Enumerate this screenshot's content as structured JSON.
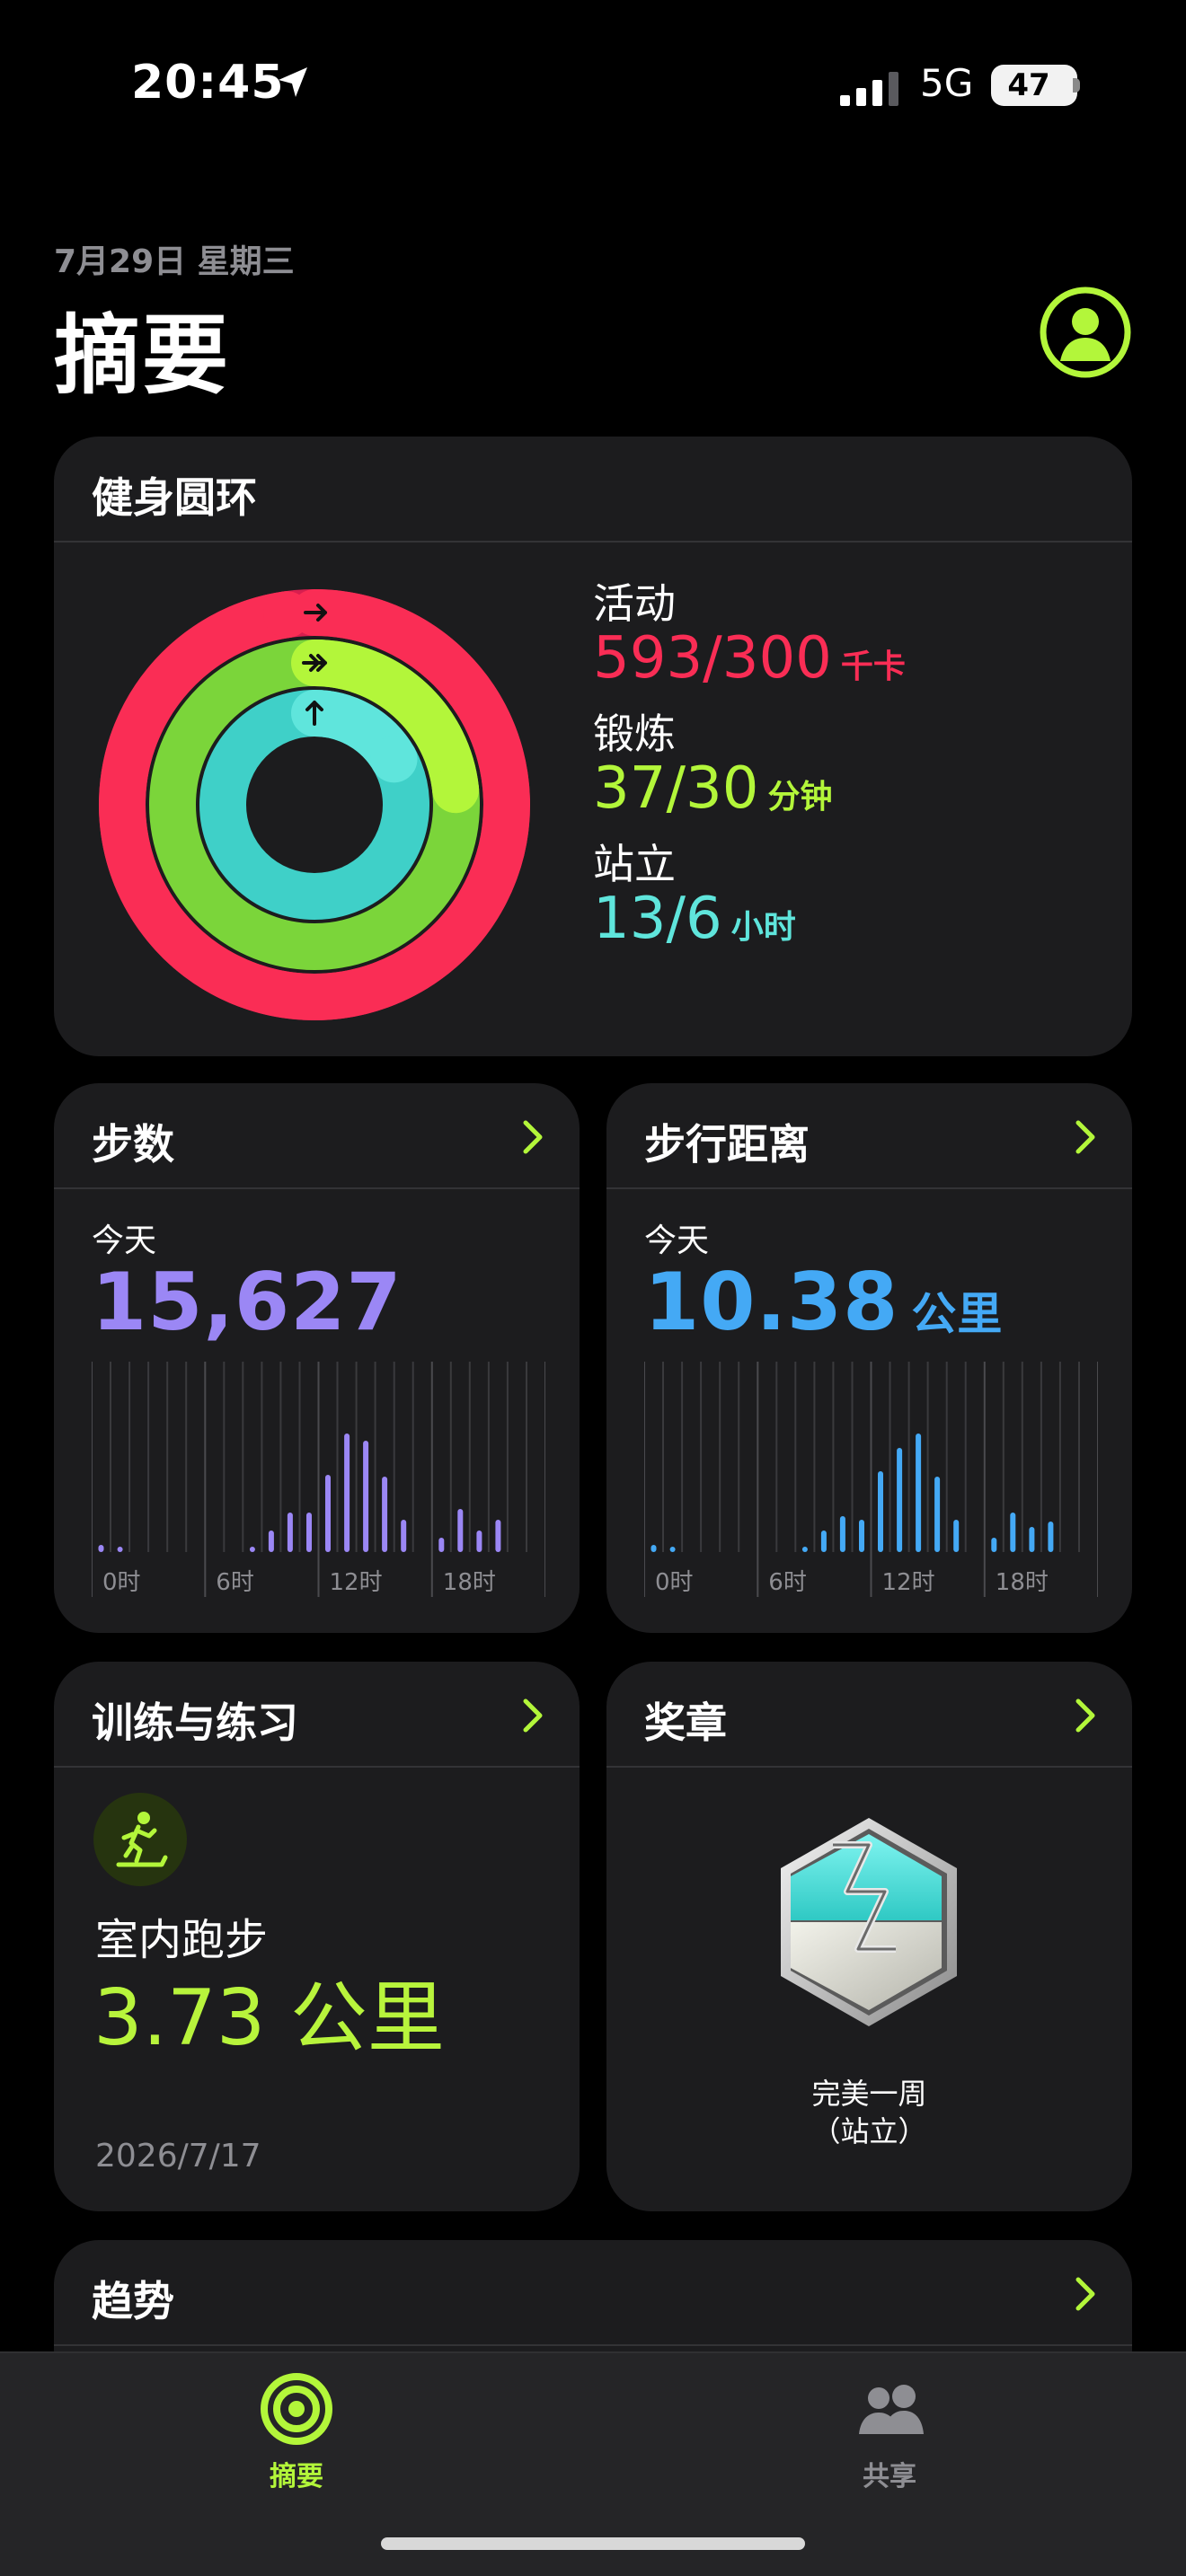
{
  "status_bar": {
    "time": "20:45",
    "network": "5G",
    "battery": "47"
  },
  "header": {
    "date": "7月29日 星期三",
    "title": "摘要"
  },
  "rings": {
    "title": "健身圆环",
    "colors": {
      "move": "#fa2d55",
      "exercise": "#b3f63a",
      "stand": "#5fe5dc"
    },
    "move": {
      "label": "活动",
      "value": "593/300",
      "unit": "千卡",
      "progress": 1.977
    },
    "exercise": {
      "label": "锻炼",
      "value": "37/30",
      "unit": "分钟",
      "progress": 1.233
    },
    "stand": {
      "label": "站立",
      "value": "13/6",
      "unit": "小时",
      "progress": 2.167
    }
  },
  "steps": {
    "title": "步数",
    "today_label": "今天",
    "value": "15,627",
    "color": "#9b87f5",
    "chart": {
      "x_tick_labels": [
        "0时",
        "6时",
        "12时",
        "18时"
      ],
      "hourly_relative": [
        0.04,
        0.03,
        0,
        0,
        0,
        0,
        0,
        0,
        0.03,
        0.12,
        0.22,
        0.22,
        0.43,
        0.66,
        0.62,
        0.42,
        0.18,
        0,
        0.08,
        0.24,
        0.12,
        0.18,
        0,
        0
      ]
    }
  },
  "distance": {
    "title": "步行距离",
    "today_label": "今天",
    "value": "10.38",
    "unit": "公里",
    "color": "#44a9f5",
    "chart": {
      "x_tick_labels": [
        "0时",
        "6时",
        "12时",
        "18时"
      ],
      "hourly_relative": [
        0.04,
        0.03,
        0,
        0,
        0,
        0,
        0,
        0,
        0.03,
        0.12,
        0.2,
        0.18,
        0.45,
        0.58,
        0.66,
        0.42,
        0.18,
        0,
        0.08,
        0.22,
        0.14,
        0.17,
        0,
        0
      ]
    }
  },
  "workouts": {
    "title": "训练与练习",
    "name": "室内跑步",
    "distance": "3.73 公里",
    "date": "2026/7/17",
    "icon": "running-figure-icon"
  },
  "awards": {
    "title": "奖章",
    "award_name_line1": "完美一周",
    "award_name_line2": "（站立）",
    "icon": "hexagon-award-badge"
  },
  "trends": {
    "title": "趋势"
  },
  "tab_bar": {
    "summary_label": "摘要",
    "sharing_label": "共享",
    "active_color": "#b3f63a",
    "inactive_color": "#8e8e93"
  }
}
